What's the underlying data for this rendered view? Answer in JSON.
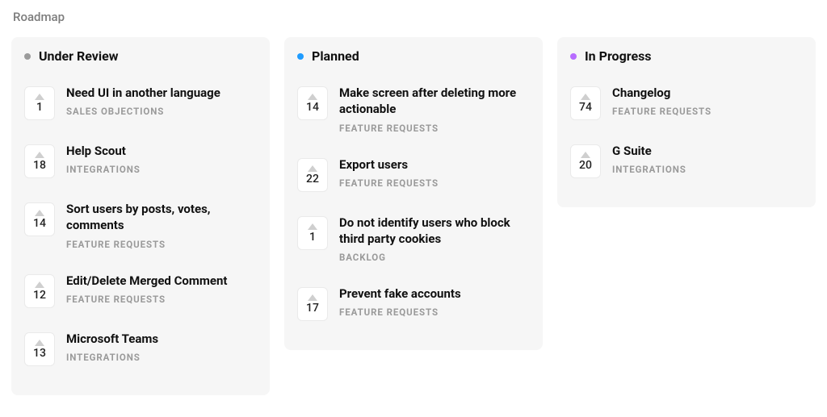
{
  "page": {
    "title": "Roadmap"
  },
  "columns": [
    {
      "id": "under-review",
      "title": "Under Review",
      "dot_color": "#9b9b9b",
      "cards": [
        {
          "votes": 1,
          "title": "Need UI in another language",
          "category": "SALES OBJECTIONS"
        },
        {
          "votes": 18,
          "title": "Help Scout",
          "category": "INTEGRATIONS"
        },
        {
          "votes": 14,
          "title": "Sort users by posts, votes, comments",
          "category": "FEATURE REQUESTS"
        },
        {
          "votes": 12,
          "title": "Edit/Delete Merged Comment",
          "category": "FEATURE REQUESTS"
        },
        {
          "votes": 13,
          "title": "Microsoft Teams",
          "category": "INTEGRATIONS"
        }
      ]
    },
    {
      "id": "planned",
      "title": "Planned",
      "dot_color": "#1f9cff",
      "cards": [
        {
          "votes": 14,
          "title": "Make screen after deleting more actionable",
          "category": "FEATURE REQUESTS"
        },
        {
          "votes": 22,
          "title": "Export users",
          "category": "FEATURE REQUESTS"
        },
        {
          "votes": 1,
          "title": "Do not identify users who block third party cookies",
          "category": "BACKLOG"
        },
        {
          "votes": 17,
          "title": "Prevent fake accounts",
          "category": "FEATURE REQUESTS"
        }
      ]
    },
    {
      "id": "in-progress",
      "title": "In Progress",
      "dot_color": "#b76cff",
      "cards": [
        {
          "votes": 74,
          "title": "Changelog",
          "category": "FEATURE REQUESTS"
        },
        {
          "votes": 20,
          "title": "G Suite",
          "category": "INTEGRATIONS"
        }
      ]
    }
  ]
}
